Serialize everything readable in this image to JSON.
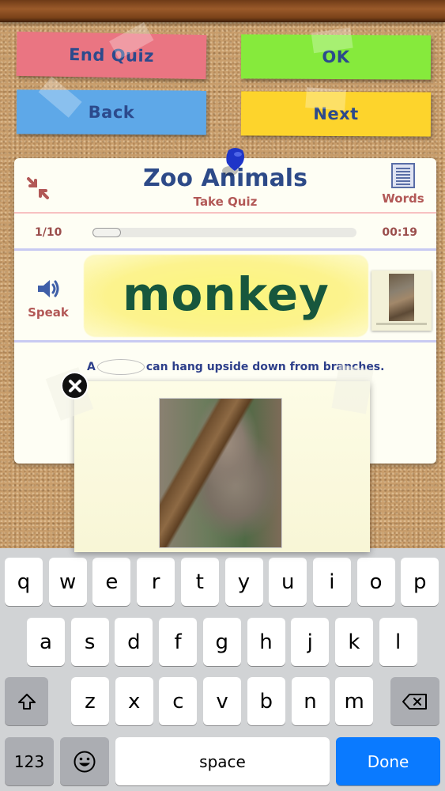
{
  "buttons": {
    "end_quiz": "End Quiz",
    "ok": "OK",
    "back": "Back",
    "next": "Next"
  },
  "card": {
    "title": "Zoo Animals",
    "subtitle": "Take Quiz",
    "words_label": "Words",
    "progress_text": "1/10",
    "progress_fraction": 0.1,
    "timer": "00:19",
    "speak_label": "Speak",
    "word": "monkey"
  },
  "popup": {
    "sentence_before": "A",
    "sentence_after": "can hang upside down from branches.",
    "blank_value": ""
  },
  "keyboard": {
    "row1": [
      "q",
      "w",
      "e",
      "r",
      "t",
      "y",
      "u",
      "i",
      "o",
      "p"
    ],
    "row2": [
      "a",
      "s",
      "d",
      "f",
      "g",
      "h",
      "j",
      "k",
      "l"
    ],
    "row3": [
      "z",
      "x",
      "c",
      "v",
      "b",
      "n",
      "m"
    ],
    "numbers_label": "123",
    "space_label": "space",
    "done_label": "Done"
  },
  "colors": {
    "end_quiz": "#ea7582",
    "ok": "#86ea3c",
    "back": "#5ea8e8",
    "next": "#fdd42c",
    "title": "#2d4a88",
    "accent_red": "#b25856",
    "word": "#17573d",
    "done": "#0a7aff"
  }
}
